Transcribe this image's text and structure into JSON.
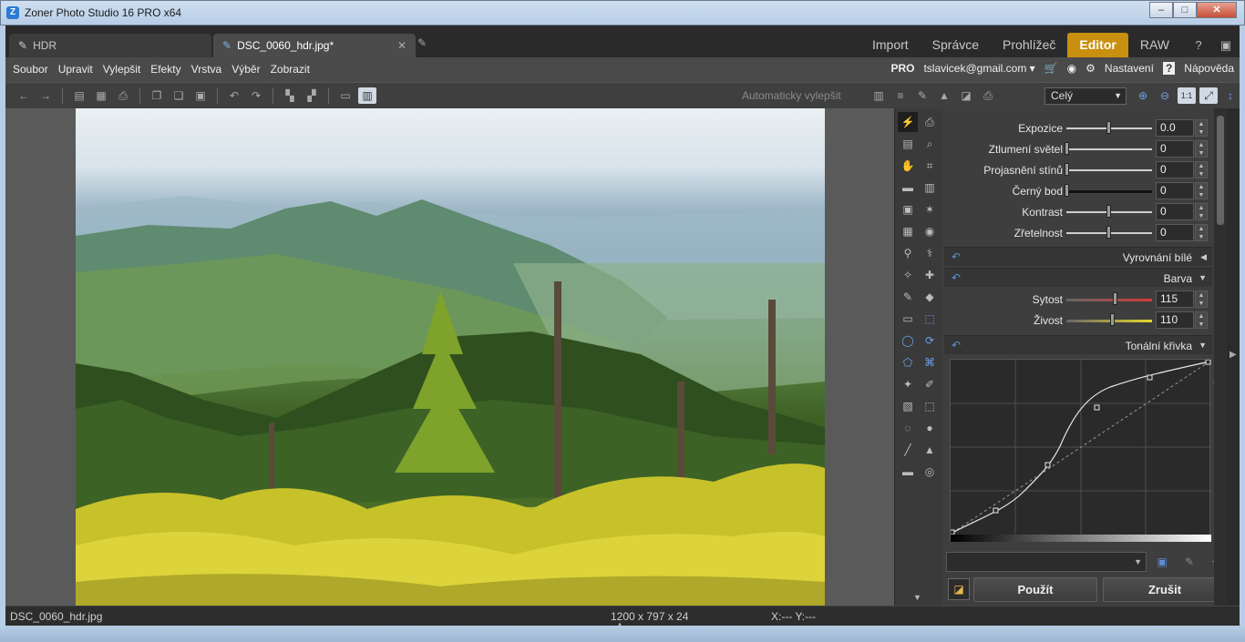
{
  "window": {
    "title": "Zoner Photo Studio 16 PRO x64",
    "minimize": "–",
    "maximize": "□",
    "close": "✕"
  },
  "tabs": [
    {
      "label": "HDR"
    },
    {
      "label": "DSC_0060_hdr.jpg*",
      "close": "✕"
    }
  ],
  "modules": [
    {
      "label": "Import"
    },
    {
      "label": "Správce"
    },
    {
      "label": "Prohlížeč"
    },
    {
      "label": "Editor",
      "active": true
    },
    {
      "label": "RAW"
    }
  ],
  "menu": {
    "items": [
      "Soubor",
      "Upravit",
      "Vylepšit",
      "Efekty",
      "Vrstva",
      "Výběr",
      "Zobrazit"
    ],
    "pro": "PRO",
    "account": "tslavicek@gmail.com ▾",
    "settings": "Nastavení",
    "help": "Nápověda"
  },
  "toolbar": {
    "auto_enhance": "Automaticky vylepšit",
    "zoom": "Celý"
  },
  "panel": {
    "sliders": [
      {
        "label": "Expozice",
        "value": "0.0",
        "pos": 0.5
      },
      {
        "label": "Ztlumení světel",
        "value": "0",
        "pos": 0.0
      },
      {
        "label": "Projasnění stínů",
        "value": "0",
        "pos": 0.0
      },
      {
        "label": "Černý bod",
        "value": "0",
        "pos": 0.0
      },
      {
        "label": "Kontrast",
        "value": "0",
        "pos": 0.5
      },
      {
        "label": "Zřetelnost",
        "value": "0",
        "pos": 0.5
      }
    ],
    "sections": {
      "white_balance": "Vyrovnání bílé",
      "color": "Barva",
      "curve": "Tonální křivka"
    },
    "color_sliders": [
      {
        "label": "Sytost",
        "value": "115",
        "pos": 0.58
      },
      {
        "label": "Živost",
        "value": "110",
        "pos": 0.54
      }
    ],
    "apply": "Použít",
    "cancel": "Zrušit"
  },
  "status": {
    "filename": "DSC_0060_hdr.jpg",
    "dimensions": "1200 x 797 x 24",
    "coords": "X:---  Y:---"
  },
  "colors": {
    "accent": "#c8900e",
    "undo": "#5b8fd6"
  }
}
